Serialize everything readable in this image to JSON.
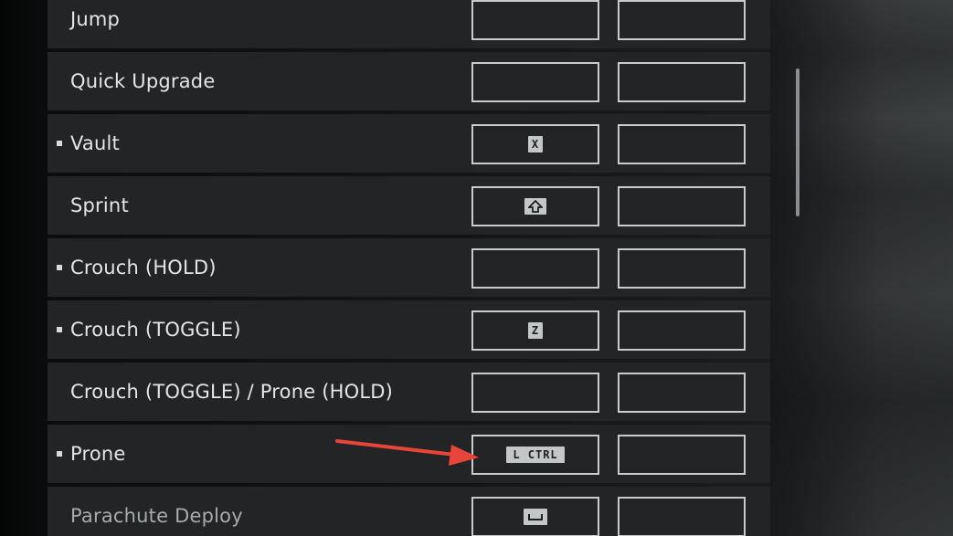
{
  "bindings": [
    {
      "label": "Jump",
      "bullet": false,
      "dim": false,
      "primary_key": "",
      "secondary_key": ""
    },
    {
      "label": "Quick Upgrade",
      "bullet": false,
      "dim": false,
      "primary_key": "",
      "secondary_key": ""
    },
    {
      "label": "Vault",
      "bullet": true,
      "dim": false,
      "primary_key": "X",
      "secondary_key": ""
    },
    {
      "label": "Sprint",
      "bullet": false,
      "dim": false,
      "primary_key": "shift-icon",
      "secondary_key": ""
    },
    {
      "label": "Crouch (HOLD)",
      "bullet": true,
      "dim": false,
      "primary_key": "",
      "secondary_key": ""
    },
    {
      "label": "Crouch (TOGGLE)",
      "bullet": true,
      "dim": false,
      "primary_key": "Z",
      "secondary_key": ""
    },
    {
      "label": "Crouch (TOGGLE) / Prone (HOLD)",
      "bullet": false,
      "dim": false,
      "primary_key": "",
      "secondary_key": ""
    },
    {
      "label": "Prone",
      "bullet": true,
      "dim": false,
      "primary_key": "L CTRL",
      "secondary_key": ""
    },
    {
      "label": "Parachute Deploy",
      "bullet": false,
      "dim": true,
      "primary_key": "space-icon",
      "secondary_key": ""
    }
  ],
  "colors": {
    "row_background": "#222425",
    "slot_border": "#c9cccc",
    "keycap_background": "#c4c7c8",
    "label_text": "#e4e6e6",
    "annotation_arrow": "#e8453a"
  }
}
